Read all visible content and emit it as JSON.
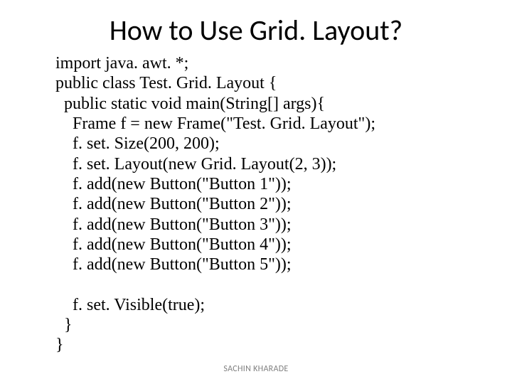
{
  "title": "How to Use Grid. Layout?",
  "code": {
    "l1": "import java. awt. *;",
    "l2": "public class Test. Grid. Layout {",
    "l3": "  public static void main(String[] args){",
    "l4": "    Frame f = new Frame(\"Test. Grid. Layout\");",
    "l5": "    f. set. Size(200, 200);",
    "l6": "    f. set. Layout(new Grid. Layout(2, 3));",
    "l7": "    f. add(new Button(\"Button 1\"));",
    "l8": "    f. add(new Button(\"Button 2\"));",
    "l9": "    f. add(new Button(\"Button 3\"));",
    "l10": "    f. add(new Button(\"Button 4\"));",
    "l11": "    f. add(new Button(\"Button 5\"));",
    "l12": "",
    "l13": "    f. set. Visible(true);",
    "l14": "  }",
    "l15": "}"
  },
  "footer": "SACHIN KHARADE"
}
